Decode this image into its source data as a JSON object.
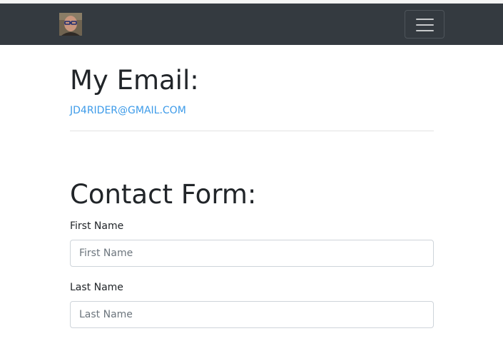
{
  "navbar": {
    "avatar_alt": "profile photo",
    "toggle_icon": "hamburger-menu-icon"
  },
  "email_section": {
    "heading": "My Email:",
    "email": "JD4RIDER@GMAIL.COM"
  },
  "contact_section": {
    "heading": "Contact Form:",
    "fields": [
      {
        "label": "First Name",
        "placeholder": "First Name",
        "value": ""
      },
      {
        "label": "Last Name",
        "placeholder": "Last Name",
        "value": ""
      }
    ]
  },
  "colors": {
    "navbar_bg": "#343a40",
    "link": "#3d9be9",
    "text": "#212529"
  }
}
